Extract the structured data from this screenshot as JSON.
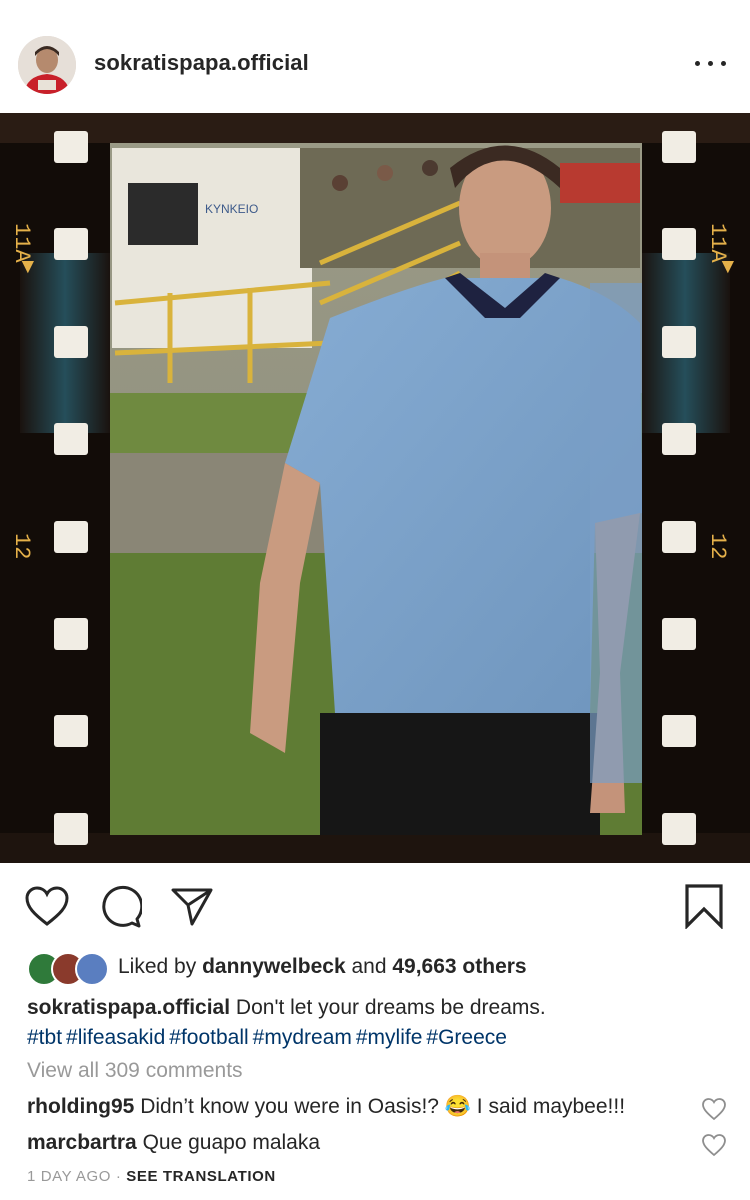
{
  "post": {
    "username": "sokratispapa.official"
  },
  "film": {
    "frame_label_top": "11A",
    "frame_label_bottom": "12",
    "arrow_glyph": "▲",
    "sign_text": "ΚΥΝΚΕΙΟ"
  },
  "actions": {
    "like_icon": "heart-icon",
    "comment_icon": "comment-icon",
    "share_icon": "share-icon",
    "save_icon": "bookmark-icon"
  },
  "likes": {
    "prefix": "Liked by",
    "user": "dannywelbeck",
    "connector": "and",
    "count": "49,663 others"
  },
  "caption": {
    "username": "sokratispapa.official",
    "text": "Don't let your dreams be dreams.",
    "hashtags": [
      "#tbt",
      "#lifeasakid",
      "#football",
      "#mydream",
      "#mylife",
      "#Greece"
    ]
  },
  "view_all_comments": "View all 309 comments",
  "comments": [
    {
      "username": "rholding95",
      "text": "Didn’t know you were in Oasis!? 😂 I said maybee!!!"
    },
    {
      "username": "marcbartra",
      "text": "Que guapo malaka"
    }
  ],
  "meta": {
    "time": "1 DAY AGO",
    "separator": "·",
    "translation": "SEE TRANSLATION"
  },
  "colors": {
    "text": "#262626",
    "hashtag": "#003569",
    "muted": "#999999",
    "jersey": "#7fa6cf"
  }
}
